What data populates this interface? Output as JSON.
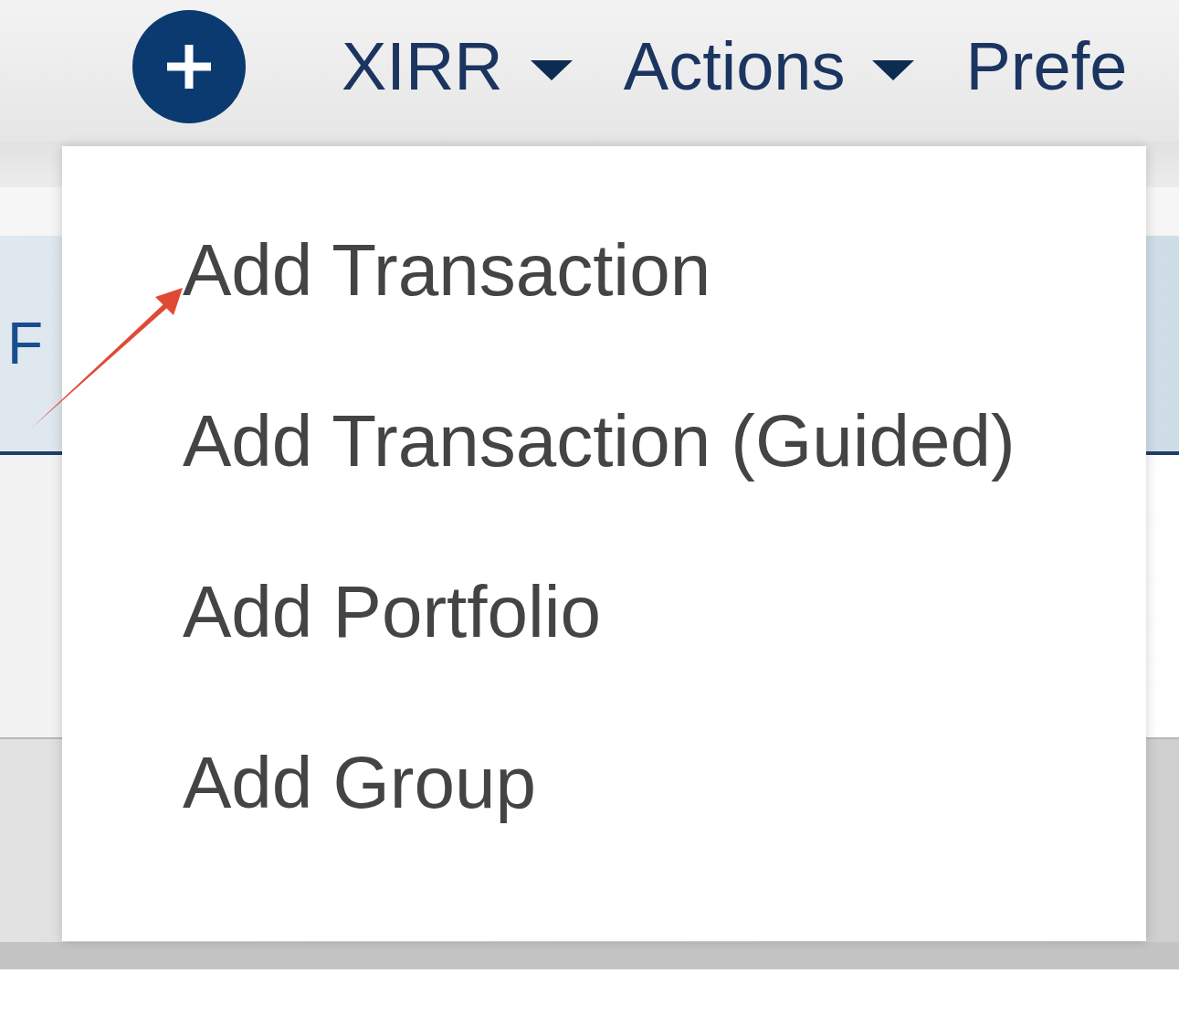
{
  "toolbar": {
    "add_button": {
      "kind": "add"
    },
    "menus": [
      {
        "label": "XIRR",
        "kind": "dropdown"
      },
      {
        "label": "Actions",
        "kind": "dropdown"
      },
      {
        "label": "Prefe",
        "kind": "link"
      }
    ]
  },
  "add_menu": {
    "expanded": true,
    "items": [
      {
        "label": "Add Transaction"
      },
      {
        "label": "Add Transaction (Guided)"
      },
      {
        "label": "Add Portfolio"
      },
      {
        "label": "Add Group"
      }
    ]
  },
  "table_header": {
    "column_1": "F"
  }
}
